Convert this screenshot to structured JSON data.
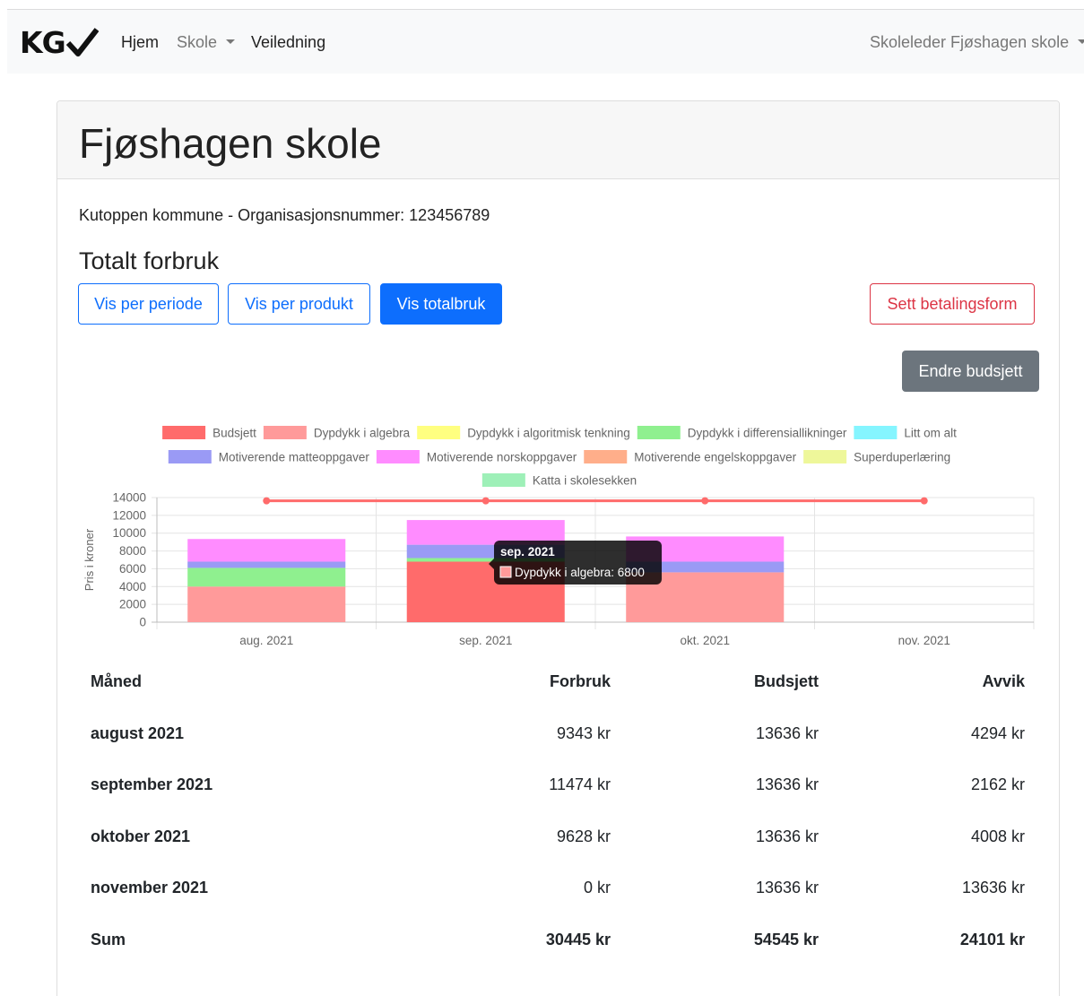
{
  "brand": {
    "logo_text": "KG"
  },
  "nav": {
    "home": "Hjem",
    "school": "Skole",
    "guide": "Veiledning",
    "user": "Skoleleder Fjøshagen skole"
  },
  "page": {
    "title": "Fjøshagen skole",
    "subtitle": "Kutoppen kommune - Organisasjonsnummer: 123456789",
    "section_title": "Totalt forbruk"
  },
  "buttons": {
    "per_period": "Vis per periode",
    "per_product": "Vis per produkt",
    "total": "Vis totalbruk",
    "payment": "Sett betalingsform",
    "edit_budget": "Endre budsjett"
  },
  "colors": {
    "primary": "#0d6efd",
    "danger": "#dc3545",
    "secondary": "#6c757d"
  },
  "chart_data": {
    "type": "bar",
    "stacked": true,
    "ylabel": "Pris i kroner",
    "ylim": [
      0,
      14000
    ],
    "yticks": [
      "0",
      "2000",
      "4000",
      "6000",
      "8000",
      "10000",
      "12000",
      "14000"
    ],
    "categories": [
      "aug. 2021",
      "sep. 2021",
      "okt. 2021",
      "nov. 2021"
    ],
    "legend_position": "top",
    "grid": true,
    "series": [
      {
        "name": "Budsjett",
        "kind": "line",
        "color": "#ff6b6b",
        "values": [
          13636,
          13636,
          13636,
          13636
        ]
      },
      {
        "name": "Dypdykk i algebra",
        "color": "#ff9a9a",
        "values": [
          4000,
          6800,
          5600,
          0
        ]
      },
      {
        "name": "Dypdykk i algoritmisk tenkning",
        "color": "#ffff80",
        "values": [
          0,
          0,
          0,
          0
        ]
      },
      {
        "name": "Dypdykk i differensiallikninger",
        "color": "#8ff08f",
        "values": [
          2100,
          400,
          0,
          0
        ]
      },
      {
        "name": "Litt om alt",
        "color": "#85f5ff",
        "values": [
          0,
          0,
          0,
          0
        ]
      },
      {
        "name": "Motiverende matteoppgaver",
        "color": "#9a9af5",
        "values": [
          700,
          1500,
          1200,
          0
        ]
      },
      {
        "name": "Motiverende norskoppgaver",
        "color": "#ff8cff",
        "values": [
          2543,
          2774,
          2828,
          0
        ]
      },
      {
        "name": "Motiverende engelskoppgaver",
        "color": "#ffae8a",
        "values": [
          0,
          0,
          0,
          0
        ]
      },
      {
        "name": "Superduperlæring",
        "color": "#eef79a",
        "values": [
          0,
          0,
          0,
          0
        ]
      },
      {
        "name": "Katta i skolesekken",
        "color": "#9ef0b8",
        "values": [
          0,
          0,
          0,
          0
        ]
      }
    ],
    "highlight": {
      "category": "sep. 2021",
      "series": "Dypdykk i algebra",
      "color": "#ff6b6b"
    },
    "tooltip": {
      "title": "sep. 2021",
      "label": "Dypdykk i algebra: 6800"
    }
  },
  "table": {
    "headers": [
      "Måned",
      "Forbruk",
      "Budsjett",
      "Avvik"
    ],
    "rows": [
      [
        "august 2021",
        "9343 kr",
        "13636 kr",
        "4294 kr"
      ],
      [
        "september 2021",
        "11474 kr",
        "13636 kr",
        "2162 kr"
      ],
      [
        "oktober 2021",
        "9628 kr",
        "13636 kr",
        "4008 kr"
      ],
      [
        "november 2021",
        "0 kr",
        "13636 kr",
        "13636 kr"
      ]
    ],
    "sum": [
      "Sum",
      "30445 kr",
      "54545 kr",
      "24101 kr"
    ]
  }
}
